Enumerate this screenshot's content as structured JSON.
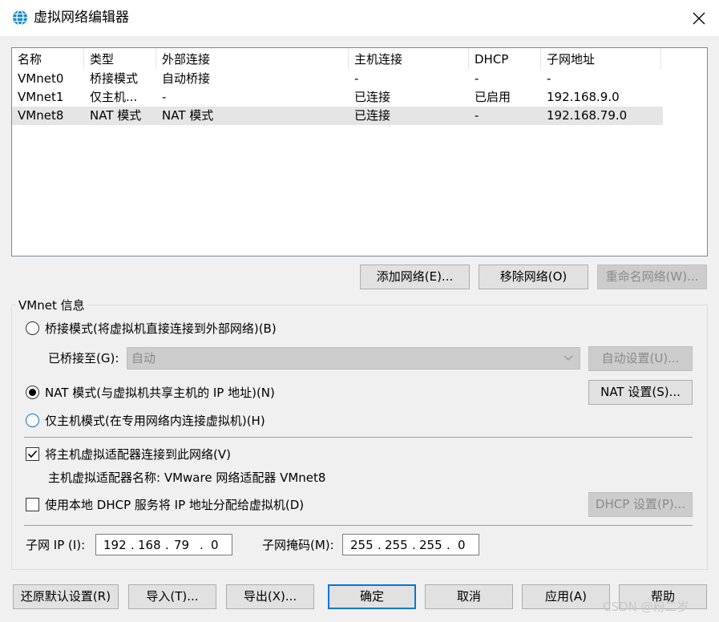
{
  "window": {
    "title": "虚拟网络编辑器",
    "close_icon": "close-icon"
  },
  "table": {
    "columns": [
      "名称",
      "类型",
      "外部连接",
      "主机连接",
      "DHCP",
      "子网地址"
    ],
    "rows": [
      [
        "VMnet0",
        "桥接模式",
        "自动桥接",
        "-",
        "-",
        "-"
      ],
      [
        "VMnet1",
        "仅主机...",
        "-",
        "已连接",
        "已启用",
        "192.168.9.0"
      ],
      [
        "VMnet8",
        "NAT 模式",
        "NAT 模式",
        "已连接",
        "-",
        "192.168.79.0"
      ]
    ],
    "selected_row": 2,
    "selected_color": "#e5e5e5"
  },
  "net_buttons": {
    "add": "添加网络(E)...",
    "remove": "移除网络(O)",
    "rename": "重命名网络(W)..."
  },
  "info": {
    "legend": "VMnet 信息",
    "bridge_label": "桥接模式(将虚拟机直接连接到外部网络)(B)",
    "bridged_to_label": "已桥接至(G):",
    "bridged_to_value": "自动",
    "auto_settings": "自动设置(U)...",
    "nat_label": "NAT 模式(与虚拟机共享主机的 IP 地址)(N)",
    "nat_settings": "NAT 设置(S)...",
    "hostonly_label": "仅主机模式(在专用网络内连接虚拟机)(H)",
    "selected_mode": "nat",
    "connect_adapter_label": "将主机虚拟适配器连接到此网络(V)",
    "connect_adapter_checked": true,
    "adapter_name_label": "主机虚拟适配器名称: VMware 网络适配器 VMnet8",
    "dhcp_label": "使用本地 DHCP 服务将 IP 地址分配给虚拟机(D)",
    "dhcp_checked": false,
    "dhcp_settings": "DHCP 设置(P)...",
    "subnet_ip_label": "子网 IP (I):",
    "subnet_ip": [
      "192",
      "168",
      "79",
      "0"
    ],
    "subnet_mask_label": "子网掩码(M):",
    "subnet_mask": [
      "255",
      "255",
      "255",
      "0"
    ]
  },
  "footer": {
    "restore": "还原默认设置(R)",
    "import": "导入(T)...",
    "export": "导出(X)...",
    "ok": "确定",
    "cancel": "取消",
    "apply": "应用(A)",
    "help": "帮助"
  },
  "watermark": "CSDN @粉二岁",
  "colors": {
    "accent": "#0078d7",
    "globe": "#1e88c8",
    "disabled_text": "#8a8a8a"
  }
}
